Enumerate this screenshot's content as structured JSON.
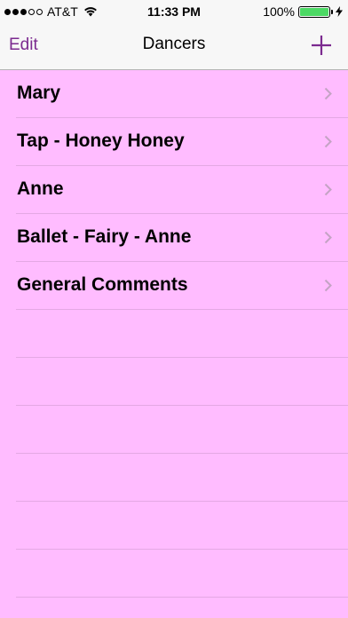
{
  "status_bar": {
    "carrier": "AT&T",
    "time": "11:33 PM",
    "battery_percent": "100%",
    "signal_bars_filled": 3,
    "signal_bars_total": 5,
    "battery_level": 1.0,
    "battery_color": "#4cd964"
  },
  "nav": {
    "edit_label": "Edit",
    "title": "Dancers",
    "add_icon": "plus-icon",
    "accent_color": "#7b2a8f"
  },
  "list": {
    "background_color": "#ffbcff",
    "items": [
      {
        "label": "Mary"
      },
      {
        "label": "Tap - Honey Honey"
      },
      {
        "label": "Anne"
      },
      {
        "label": "Ballet - Fairy - Anne"
      },
      {
        "label": "General Comments"
      }
    ],
    "empty_rows": 6
  }
}
